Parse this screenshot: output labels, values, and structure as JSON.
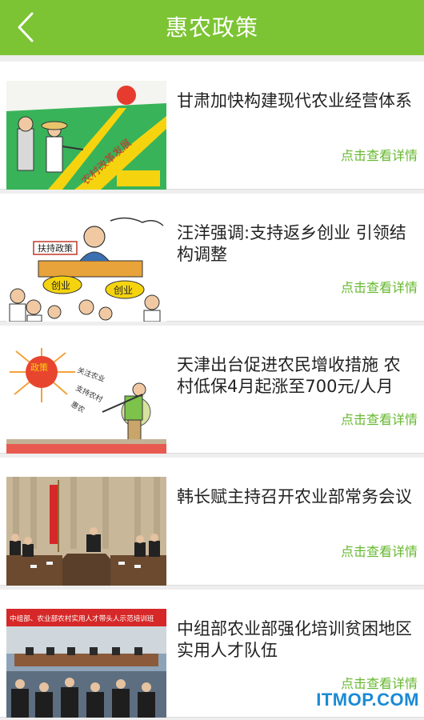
{
  "header": {
    "title": "惠农政策",
    "back_icon": "back-arrow-icon"
  },
  "colors": {
    "accent": "#7cc433",
    "link": "#66b82e",
    "watermark": "#1a8ad4"
  },
  "articles": [
    {
      "title": "甘肃加快构建现代农业经营体系",
      "link": "点击查看详情",
      "image_text": "农村改革发展"
    },
    {
      "title": "汪洋强调:支持返乡创业 引领结构调整",
      "link": "点击查看详情",
      "image_text": [
        "扶持政策",
        "创业",
        "创业"
      ]
    },
    {
      "title": "天津出台促进农民增收措施 农村低保4月起涨至700元/人月",
      "link": "点击查看详情",
      "image_text": [
        "政策",
        "关注农业",
        "支持农村",
        "惠农"
      ]
    },
    {
      "title": "韩长赋主持召开农业部常务会议",
      "link": "点击查看详情"
    },
    {
      "title": "中组部农业部强化培训贫困地区实用人才队伍",
      "link": "点击查看详情",
      "image_text": "中组部、农业部农村实用人才带头人示范培训班"
    }
  ],
  "watermark": "ITMOP.COM"
}
